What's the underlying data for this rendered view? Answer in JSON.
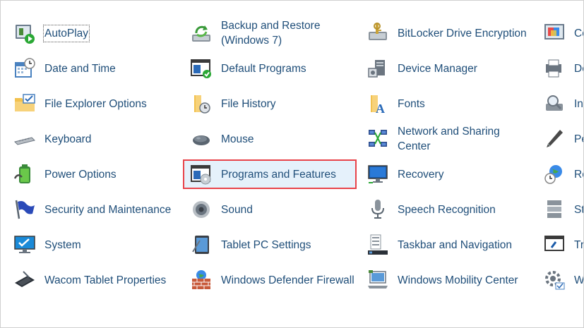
{
  "items": [
    {
      "label": "AutoPlay",
      "icon": "autoplay-icon"
    },
    {
      "label": "Backup and Restore (Windows 7)",
      "icon": "backup-restore-icon"
    },
    {
      "label": "BitLocker Drive Encryption",
      "icon": "bitlocker-icon"
    },
    {
      "label": "Co",
      "icon": "color-management-icon"
    },
    {
      "label": "Date and Time",
      "icon": "calendar-clock-icon"
    },
    {
      "label": "Default Programs",
      "icon": "default-programs-icon"
    },
    {
      "label": "Device Manager",
      "icon": "device-manager-icon"
    },
    {
      "label": "De",
      "icon": "devices-printers-icon"
    },
    {
      "label": "File Explorer Options",
      "icon": "folder-check-icon"
    },
    {
      "label": "File History",
      "icon": "file-history-icon"
    },
    {
      "label": "Fonts",
      "icon": "fonts-folder-icon"
    },
    {
      "label": "In",
      "icon": "indexing-icon"
    },
    {
      "label": "Keyboard",
      "icon": "keyboard-icon"
    },
    {
      "label": "Mouse",
      "icon": "mouse-icon"
    },
    {
      "label": "Network and Sharing Center",
      "icon": "network-icon"
    },
    {
      "label": "Pe",
      "icon": "pen-icon"
    },
    {
      "label": "Power Options",
      "icon": "battery-icon"
    },
    {
      "label": "Programs and Features",
      "icon": "programs-features-icon"
    },
    {
      "label": "Recovery",
      "icon": "recovery-icon"
    },
    {
      "label": "Re",
      "icon": "region-globe-icon"
    },
    {
      "label": "Security and Maintenance",
      "icon": "flag-icon"
    },
    {
      "label": "Sound",
      "icon": "speaker-icon"
    },
    {
      "label": "Speech Recognition",
      "icon": "microphone-icon"
    },
    {
      "label": "St",
      "icon": "storage-icon"
    },
    {
      "label": "System",
      "icon": "system-monitor-icon"
    },
    {
      "label": "Tablet PC Settings",
      "icon": "tablet-icon"
    },
    {
      "label": "Taskbar and Navigation",
      "icon": "taskbar-icon"
    },
    {
      "label": "Tr",
      "icon": "troubleshooting-icon"
    },
    {
      "label": "Wacom Tablet Properties",
      "icon": "wacom-tablet-icon"
    },
    {
      "label": "Windows Defender Firewall",
      "icon": "firewall-icon"
    },
    {
      "label": "Windows Mobility Center",
      "icon": "mobility-center-icon"
    },
    {
      "label": "W",
      "icon": "work-folders-icon"
    }
  ],
  "colors": {
    "link": "#1f4e79",
    "selection_border": "#e8434a",
    "selection_fill": "#e5f1fb"
  }
}
